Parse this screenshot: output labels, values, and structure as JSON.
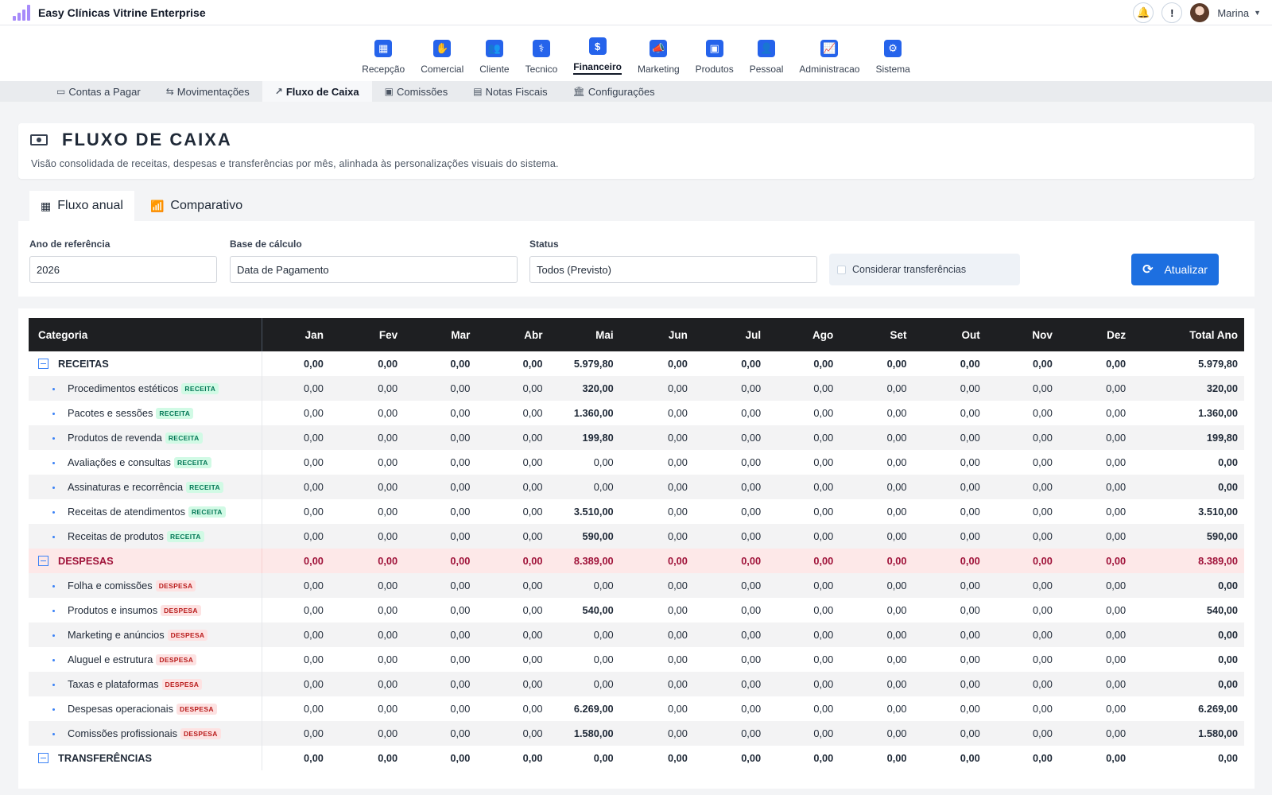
{
  "app": {
    "title": "Easy Clínicas Vitrine Enterprise",
    "user": "Marina",
    "notify_glyph": "🔔",
    "alert_glyph": "!"
  },
  "nav": {
    "items": [
      {
        "key": "recepcao",
        "label": "Recepção",
        "icon": "reception-icon",
        "glyph": "▦",
        "active": false
      },
      {
        "key": "comercial",
        "label": "Comercial",
        "icon": "handshake-icon",
        "glyph": "✋",
        "active": false
      },
      {
        "key": "cliente",
        "label": "Cliente",
        "icon": "users-icon",
        "glyph": "👥",
        "active": false
      },
      {
        "key": "tecnico",
        "label": "Tecnico",
        "icon": "clipboard-pulse-icon",
        "glyph": "⚕",
        "active": false
      },
      {
        "key": "financeiro",
        "label": "Financeiro",
        "icon": "dollar-icon",
        "glyph": "$",
        "active": true
      },
      {
        "key": "marketing",
        "label": "Marketing",
        "icon": "megaphone-icon",
        "glyph": "📣",
        "active": false
      },
      {
        "key": "produtos",
        "label": "Produtos",
        "icon": "box-icon",
        "glyph": "▣",
        "active": false
      },
      {
        "key": "pessoal",
        "label": "Pessoal",
        "icon": "id-badge-icon",
        "glyph": "👤",
        "active": false
      },
      {
        "key": "administracao",
        "label": "Administracao",
        "icon": "chart-line-icon",
        "glyph": "📈",
        "active": false
      },
      {
        "key": "sistema",
        "label": "Sistema",
        "icon": "gear-icon",
        "glyph": "⚙",
        "active": false
      }
    ]
  },
  "subnav": {
    "items": [
      {
        "key": "contas",
        "label": "Contas a Pagar",
        "icon": "wallet-icon",
        "glyph": "▭",
        "active": false
      },
      {
        "key": "movimentacoes",
        "label": "Movimentações",
        "icon": "arrows-exchange-icon",
        "glyph": "⇆",
        "active": false
      },
      {
        "key": "fluxo",
        "label": "Fluxo de Caixa",
        "icon": "chart-line-icon",
        "glyph": "↗",
        "active": true
      },
      {
        "key": "comissoes",
        "label": "Comissões",
        "icon": "cash-icon",
        "glyph": "▣",
        "active": false
      },
      {
        "key": "notas",
        "label": "Notas Fiscais",
        "icon": "receipt-icon",
        "glyph": "▤",
        "active": false
      },
      {
        "key": "config",
        "label": "Configurações",
        "icon": "bank-icon",
        "glyph": "🏛",
        "active": false
      }
    ]
  },
  "page": {
    "title": "FLUXO DE CAIXA",
    "subtitle": "Visão consolidada de receitas, despesas e transferências por mês, alinhada às personalizações visuais do sistema."
  },
  "tabs": {
    "annual": {
      "label": "Fluxo anual",
      "icon": "table-icon",
      "glyph": "▦"
    },
    "compare": {
      "label": "Comparativo",
      "icon": "bar-chart-icon",
      "glyph": "📶"
    }
  },
  "filters": {
    "year": {
      "label": "Ano de referência",
      "value": "2026"
    },
    "base": {
      "label": "Base de cálculo",
      "value": "Data de Pagamento"
    },
    "status": {
      "label": "Status",
      "value": "Todos (Previsto)"
    },
    "transfers": {
      "label": "Considerar transferências",
      "checked": false
    },
    "update_button": {
      "label": "Atualizar",
      "icon": "refresh-icon",
      "glyph": "⟳"
    }
  },
  "table": {
    "headers": [
      "Categoria",
      "Jan",
      "Fev",
      "Mar",
      "Abr",
      "Mai",
      "Jun",
      "Jul",
      "Ago",
      "Set",
      "Out",
      "Nov",
      "Dez",
      "Total Ano"
    ],
    "rows": [
      {
        "type": "group",
        "group": "receitas",
        "label": "RECEITAS",
        "values": [
          "0,00",
          "0,00",
          "0,00",
          "0,00",
          "5.979,80",
          "0,00",
          "0,00",
          "0,00",
          "0,00",
          "0,00",
          "0,00",
          "0,00",
          "5.979,80"
        ]
      },
      {
        "type": "item",
        "label": "Procedimentos estéticos",
        "badge": "RECEITA",
        "kind": "rec",
        "values": [
          "0,00",
          "0,00",
          "0,00",
          "0,00",
          "320,00",
          "0,00",
          "0,00",
          "0,00",
          "0,00",
          "0,00",
          "0,00",
          "0,00",
          "320,00"
        ]
      },
      {
        "type": "item",
        "label": "Pacotes e sessões",
        "badge": "RECEITA",
        "kind": "rec",
        "values": [
          "0,00",
          "0,00",
          "0,00",
          "0,00",
          "1.360,00",
          "0,00",
          "0,00",
          "0,00",
          "0,00",
          "0,00",
          "0,00",
          "0,00",
          "1.360,00"
        ]
      },
      {
        "type": "item",
        "label": "Produtos de revenda",
        "badge": "RECEITA",
        "kind": "rec",
        "values": [
          "0,00",
          "0,00",
          "0,00",
          "0,00",
          "199,80",
          "0,00",
          "0,00",
          "0,00",
          "0,00",
          "0,00",
          "0,00",
          "0,00",
          "199,80"
        ]
      },
      {
        "type": "item",
        "label": "Avaliações e consultas",
        "badge": "RECEITA",
        "kind": "rec",
        "values": [
          "0,00",
          "0,00",
          "0,00",
          "0,00",
          "0,00",
          "0,00",
          "0,00",
          "0,00",
          "0,00",
          "0,00",
          "0,00",
          "0,00",
          "0,00"
        ]
      },
      {
        "type": "item",
        "label": "Assinaturas e recorrência",
        "badge": "RECEITA",
        "kind": "rec",
        "values": [
          "0,00",
          "0,00",
          "0,00",
          "0,00",
          "0,00",
          "0,00",
          "0,00",
          "0,00",
          "0,00",
          "0,00",
          "0,00",
          "0,00",
          "0,00"
        ]
      },
      {
        "type": "item",
        "label": "Receitas de atendimentos",
        "badge": "RECEITA",
        "kind": "rec",
        "values": [
          "0,00",
          "0,00",
          "0,00",
          "0,00",
          "3.510,00",
          "0,00",
          "0,00",
          "0,00",
          "0,00",
          "0,00",
          "0,00",
          "0,00",
          "3.510,00"
        ]
      },
      {
        "type": "item",
        "label": "Receitas de produtos",
        "badge": "RECEITA",
        "kind": "rec",
        "values": [
          "0,00",
          "0,00",
          "0,00",
          "0,00",
          "590,00",
          "0,00",
          "0,00",
          "0,00",
          "0,00",
          "0,00",
          "0,00",
          "0,00",
          "590,00"
        ]
      },
      {
        "type": "group",
        "group": "despesas",
        "label": "DESPESAS",
        "values": [
          "0,00",
          "0,00",
          "0,00",
          "0,00",
          "8.389,00",
          "0,00",
          "0,00",
          "0,00",
          "0,00",
          "0,00",
          "0,00",
          "0,00",
          "8.389,00"
        ]
      },
      {
        "type": "item",
        "label": "Folha e comissões",
        "badge": "DESPESA",
        "kind": "desp",
        "values": [
          "0,00",
          "0,00",
          "0,00",
          "0,00",
          "0,00",
          "0,00",
          "0,00",
          "0,00",
          "0,00",
          "0,00",
          "0,00",
          "0,00",
          "0,00"
        ]
      },
      {
        "type": "item",
        "label": "Produtos e insumos",
        "badge": "DESPESA",
        "kind": "desp",
        "values": [
          "0,00",
          "0,00",
          "0,00",
          "0,00",
          "540,00",
          "0,00",
          "0,00",
          "0,00",
          "0,00",
          "0,00",
          "0,00",
          "0,00",
          "540,00"
        ]
      },
      {
        "type": "item",
        "label": "Marketing e anúncios",
        "badge": "DESPESA",
        "kind": "desp",
        "values": [
          "0,00",
          "0,00",
          "0,00",
          "0,00",
          "0,00",
          "0,00",
          "0,00",
          "0,00",
          "0,00",
          "0,00",
          "0,00",
          "0,00",
          "0,00"
        ]
      },
      {
        "type": "item",
        "label": "Aluguel e estrutura",
        "badge": "DESPESA",
        "kind": "desp",
        "values": [
          "0,00",
          "0,00",
          "0,00",
          "0,00",
          "0,00",
          "0,00",
          "0,00",
          "0,00",
          "0,00",
          "0,00",
          "0,00",
          "0,00",
          "0,00"
        ]
      },
      {
        "type": "item",
        "label": "Taxas e plataformas",
        "badge": "DESPESA",
        "kind": "desp",
        "values": [
          "0,00",
          "0,00",
          "0,00",
          "0,00",
          "0,00",
          "0,00",
          "0,00",
          "0,00",
          "0,00",
          "0,00",
          "0,00",
          "0,00",
          "0,00"
        ]
      },
      {
        "type": "item",
        "label": "Despesas operacionais",
        "badge": "DESPESA",
        "kind": "desp",
        "values": [
          "0,00",
          "0,00",
          "0,00",
          "0,00",
          "6.269,00",
          "0,00",
          "0,00",
          "0,00",
          "0,00",
          "0,00",
          "0,00",
          "0,00",
          "6.269,00"
        ]
      },
      {
        "type": "item",
        "label": "Comissões profissionais",
        "badge": "DESPESA",
        "kind": "desp",
        "values": [
          "0,00",
          "0,00",
          "0,00",
          "0,00",
          "1.580,00",
          "0,00",
          "0,00",
          "0,00",
          "0,00",
          "0,00",
          "0,00",
          "0,00",
          "1.580,00"
        ]
      },
      {
        "type": "group",
        "group": "transferencias",
        "label": "TRANSFERÊNCIAS",
        "values": [
          "0,00",
          "0,00",
          "0,00",
          "0,00",
          "0,00",
          "0,00",
          "0,00",
          "0,00",
          "0,00",
          "0,00",
          "0,00",
          "0,00",
          "0,00"
        ]
      }
    ]
  },
  "colors": {
    "accent": "#2563eb",
    "button": "#1d6fe0",
    "header_bg": "#1e1f22",
    "despesas_row": "#fde8e8",
    "despesas_text": "#9f1239",
    "receita_badge": "#047857",
    "despesa_badge": "#b91c1c"
  }
}
